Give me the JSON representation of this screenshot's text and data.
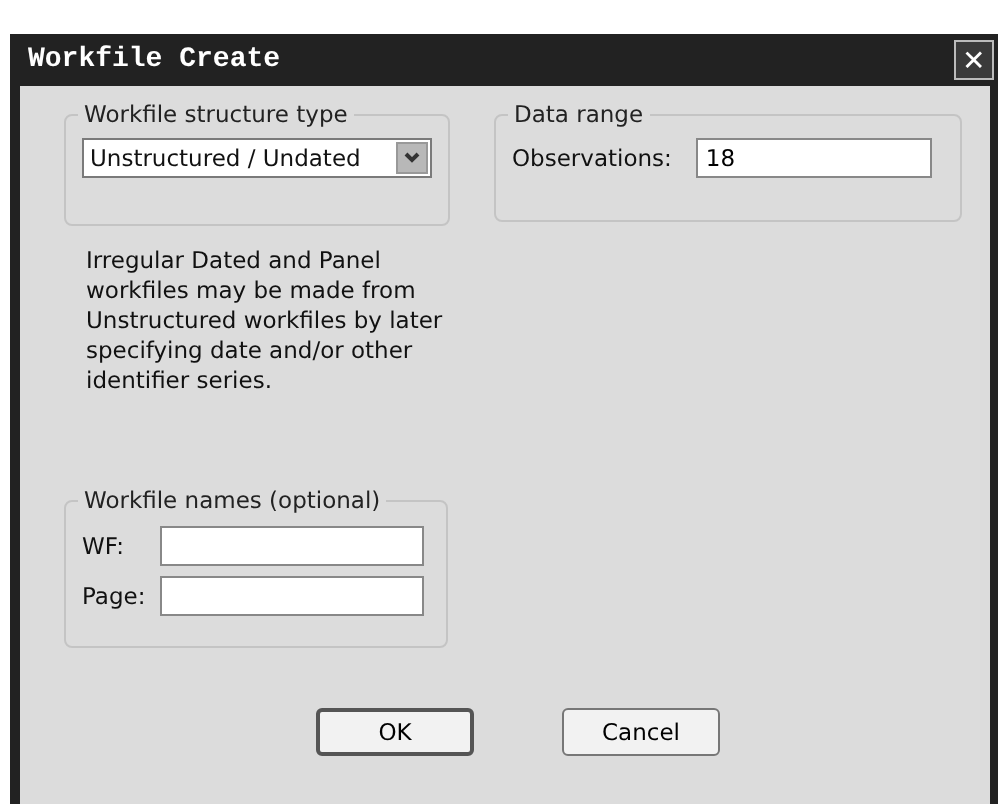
{
  "window": {
    "title": "Workfile Create",
    "close": "✕"
  },
  "structure_group": {
    "title": "Workfile structure type",
    "dropdown": {
      "value": "Unstructured / Undated"
    }
  },
  "data_range_group": {
    "title": "Data range",
    "fields": [
      {
        "label": "Observations:",
        "value": "18"
      }
    ]
  },
  "description": "Irregular Dated and Panel workfiles may be made from Unstructured workfiles by later specifying date and/or other identifier series.",
  "names_group": {
    "title": "Workfile names (optional)",
    "fields": [
      {
        "label": "WF:"
      },
      {
        "label": "Page:"
      }
    ]
  },
  "buttons": [
    {
      "label": "OK",
      "default": true
    },
    {
      "label": "Cancel",
      "default": false
    }
  ]
}
